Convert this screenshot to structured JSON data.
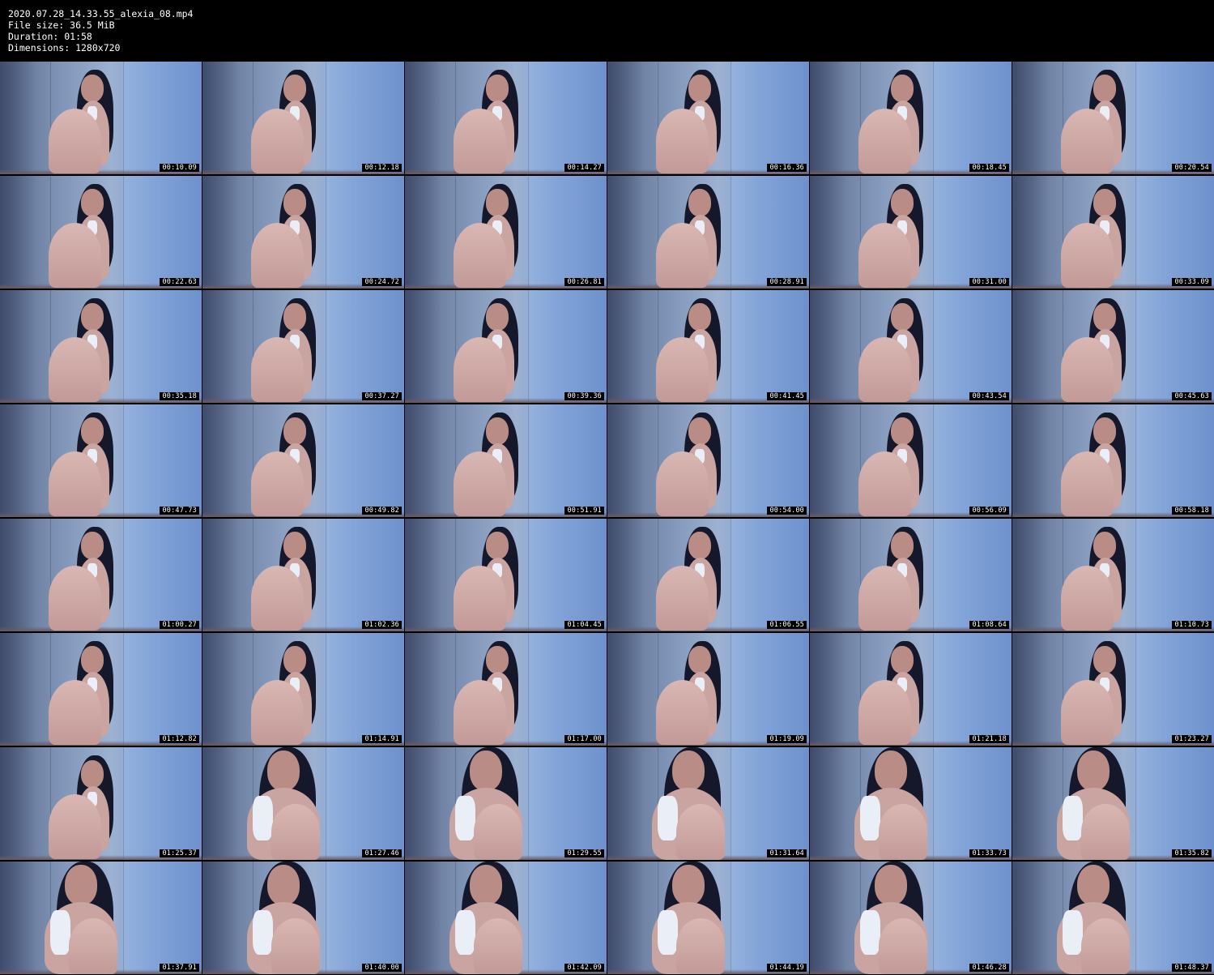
{
  "file_info": {
    "filename": "2020.07.28_14.33.55_alexia_08.mp4",
    "file_size": "File size: 36.5 MiB",
    "duration": "Duration: 01:58",
    "dimensions": "Dimensions: 1280x720"
  },
  "thumbnails": [
    {
      "timestamp": "00:10.09",
      "scene": "seated-far"
    },
    {
      "timestamp": "00:12.18",
      "scene": "seated-far"
    },
    {
      "timestamp": "00:14.27",
      "scene": "seated-far"
    },
    {
      "timestamp": "00:16.36",
      "scene": "seated-far"
    },
    {
      "timestamp": "00:18.45",
      "scene": "seated-far"
    },
    {
      "timestamp": "00:20.54",
      "scene": "seated-far"
    },
    {
      "timestamp": "00:22.63",
      "scene": "seated-far"
    },
    {
      "timestamp": "00:24.72",
      "scene": "seated-far"
    },
    {
      "timestamp": "00:26.81",
      "scene": "seated-far"
    },
    {
      "timestamp": "00:28.91",
      "scene": "seated-far"
    },
    {
      "timestamp": "00:31.00",
      "scene": "seated-far"
    },
    {
      "timestamp": "00:33.09",
      "scene": "seated-far"
    },
    {
      "timestamp": "00:35.18",
      "scene": "seated-far"
    },
    {
      "timestamp": "00:37.27",
      "scene": "seated-far"
    },
    {
      "timestamp": "00:39.36",
      "scene": "seated-far"
    },
    {
      "timestamp": "00:41.45",
      "scene": "seated-far"
    },
    {
      "timestamp": "00:43.54",
      "scene": "seated-far"
    },
    {
      "timestamp": "00:45.63",
      "scene": "seated-far"
    },
    {
      "timestamp": "00:47.73",
      "scene": "seated-far"
    },
    {
      "timestamp": "00:49.82",
      "scene": "seated-far"
    },
    {
      "timestamp": "00:51.91",
      "scene": "seated-far"
    },
    {
      "timestamp": "00:54.00",
      "scene": "seated-far"
    },
    {
      "timestamp": "00:56.09",
      "scene": "seated-far"
    },
    {
      "timestamp": "00:58.18",
      "scene": "seated-far"
    },
    {
      "timestamp": "01:00.27",
      "scene": "seated-far"
    },
    {
      "timestamp": "01:02.36",
      "scene": "seated-far"
    },
    {
      "timestamp": "01:04.45",
      "scene": "seated-far"
    },
    {
      "timestamp": "01:06.55",
      "scene": "seated-far"
    },
    {
      "timestamp": "01:08.64",
      "scene": "seated-far"
    },
    {
      "timestamp": "01:10.73",
      "scene": "seated-far"
    },
    {
      "timestamp": "01:12.82",
      "scene": "seated-far"
    },
    {
      "timestamp": "01:14.91",
      "scene": "seated-far"
    },
    {
      "timestamp": "01:17.00",
      "scene": "seated-far"
    },
    {
      "timestamp": "01:19.09",
      "scene": "seated-far"
    },
    {
      "timestamp": "01:21.18",
      "scene": "seated-far"
    },
    {
      "timestamp": "01:23.27",
      "scene": "seated-far"
    },
    {
      "timestamp": "01:25.37",
      "scene": "seated-far"
    },
    {
      "timestamp": "01:27.46",
      "scene": "close"
    },
    {
      "timestamp": "01:29.55",
      "scene": "close"
    },
    {
      "timestamp": "01:31.64",
      "scene": "close"
    },
    {
      "timestamp": "01:33.73",
      "scene": "close"
    },
    {
      "timestamp": "01:35.82",
      "scene": "close"
    },
    {
      "timestamp": "01:37.91",
      "scene": "close"
    },
    {
      "timestamp": "01:40.00",
      "scene": "close"
    },
    {
      "timestamp": "01:42.09",
      "scene": "close"
    },
    {
      "timestamp": "01:44.19",
      "scene": "close"
    },
    {
      "timestamp": "01:46.28",
      "scene": "close"
    },
    {
      "timestamp": "01:48.37",
      "scene": "close"
    }
  ]
}
